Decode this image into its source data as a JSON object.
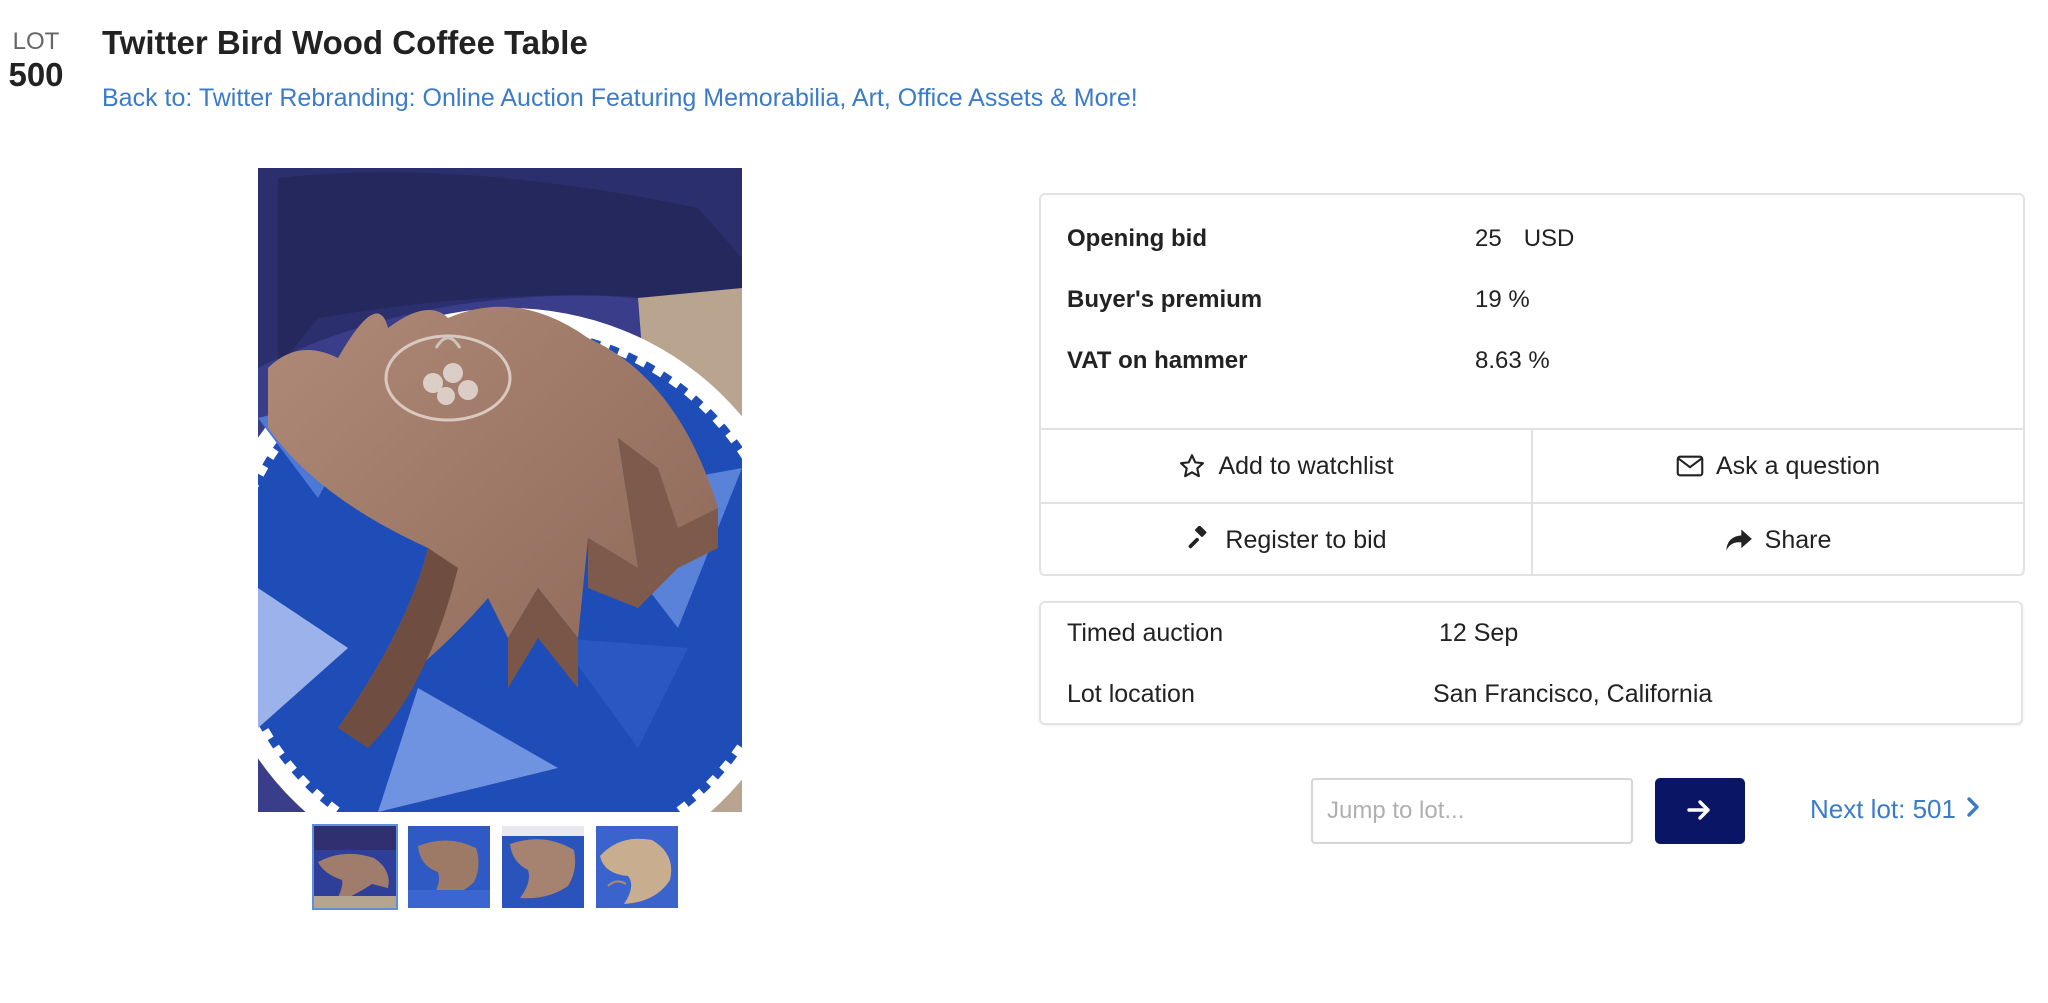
{
  "lot": {
    "label": "LOT",
    "number": "500"
  },
  "title": "Twitter Bird Wood Coffee Table",
  "back_link": "Back to: Twitter Rebranding: Online Auction Featuring Memorabilia, Art, Office Assets & More!",
  "bid_info": {
    "opening_bid": {
      "label": "Opening bid",
      "value": "25",
      "unit": "USD"
    },
    "buyers_premium": {
      "label": "Buyer's premium",
      "value": "19 %"
    },
    "vat": {
      "label": "VAT on hammer",
      "value": "8.63 %"
    }
  },
  "actions": {
    "watchlist": "Add to watchlist",
    "ask": "Ask a question",
    "register": "Register to bid",
    "share": "Share"
  },
  "details": {
    "auction_type": {
      "label": "Timed auction",
      "value": "12 Sep"
    },
    "location": {
      "label": "Lot location",
      "value": "San Francisco, California"
    }
  },
  "navigation": {
    "jump_placeholder": "Jump to lot...",
    "next_lot": "Next lot: 501"
  },
  "colors": {
    "link": "#3b7bc8",
    "go_button": "#0a1566",
    "border": "#e2e2e2"
  },
  "icons": {
    "watchlist": "star-outline-icon",
    "ask": "envelope-icon",
    "register": "gavel-icon",
    "share": "share-arrow-icon",
    "go": "arrow-right-icon",
    "next": "chevron-right-icon"
  }
}
